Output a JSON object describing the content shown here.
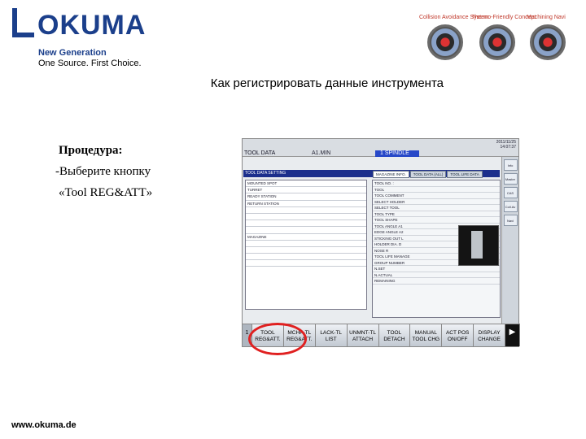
{
  "header": {
    "brand": "OKUMA",
    "tagline_1": "New Generation",
    "tagline_2": "One Source. First Choice.",
    "badges": [
      {
        "caption": "Collision Avoidance System",
        "icon": "collision-avoidance-badge"
      },
      {
        "caption": "Thermo-Friendly Concept",
        "icon": "thermo-friendly-badge"
      },
      {
        "caption": "Machining Navi",
        "icon": "machining-navi-badge"
      }
    ]
  },
  "slide": {
    "title": "Как регистрировать данные инструмента",
    "procedure_heading": "Процедура:",
    "step_line1": "-Выберите кнопку",
    "step_line2": "«Tool REG&ATT»",
    "footer_url": "www.okuma.de"
  },
  "screen": {
    "mode": "TOOL DATA",
    "program": "A1.MIN",
    "spindle": "1 SPINDLE",
    "date": "2011/11/25",
    "time": "14:07:37",
    "panel_title": "TOOL DATA SETTING",
    "tabs": [
      "MAGAZINE INFO.",
      "TOOL DATA (ALL)",
      "TOOL LIFE DATA"
    ],
    "left_rows": [
      "MOUNTED SPOT",
      "TURRET",
      "READY STATION",
      "RETURN STATION",
      "MAGAZINE"
    ],
    "right_rows": [
      "TOOL NO. :",
      "TOOL",
      "TOOL COMMENT",
      "SELECT HOLDER",
      "SELECT TOOL",
      "TOOL TYPE",
      "TOOL SHAPE",
      "TOOL ANGLE A1",
      "EDGE ANGLE A2",
      "STICKING OUT L",
      "HOLDER DIA. D",
      "NOSE R",
      "TOOL LIFE MANAGE",
      "GROUP NUMBER",
      "N.SET",
      "N.ACTUAL",
      "REMAINING"
    ],
    "side_buttons": [
      "Info",
      "Master",
      "CAS",
      "Coll.Av",
      "Navi"
    ],
    "function_keys": [
      "TOOL REG&ATT.",
      "MCHP-TL REG&ATT.",
      "LACK-TL LIST",
      "UNMNT-TL ATTACH",
      "TOOL DETACH",
      "MANUAL TOOL CHG",
      "ACT POS ON/OFF",
      "DISPLAY CHANGE"
    ]
  }
}
